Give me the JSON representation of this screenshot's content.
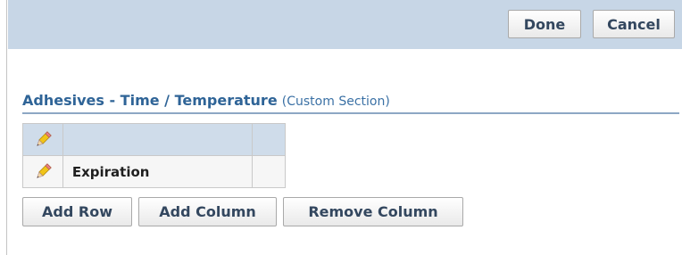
{
  "header": {
    "done_label": "Done",
    "cancel_label": "Cancel"
  },
  "section": {
    "title": "Adhesives - Time / Temperature",
    "subtitle": "(Custom Section)"
  },
  "grid": {
    "rows": [
      {
        "label": ""
      },
      {
        "label": "Expiration"
      }
    ]
  },
  "actions": {
    "add_row_label": "Add Row",
    "add_column_label": "Add Column",
    "remove_column_label": "Remove Column"
  },
  "colors": {
    "header_bar": "#c7d6e6",
    "title_blue": "#2f6497",
    "grid_header": "#cfdcea"
  },
  "icons": {
    "edit": "pencil-icon"
  }
}
